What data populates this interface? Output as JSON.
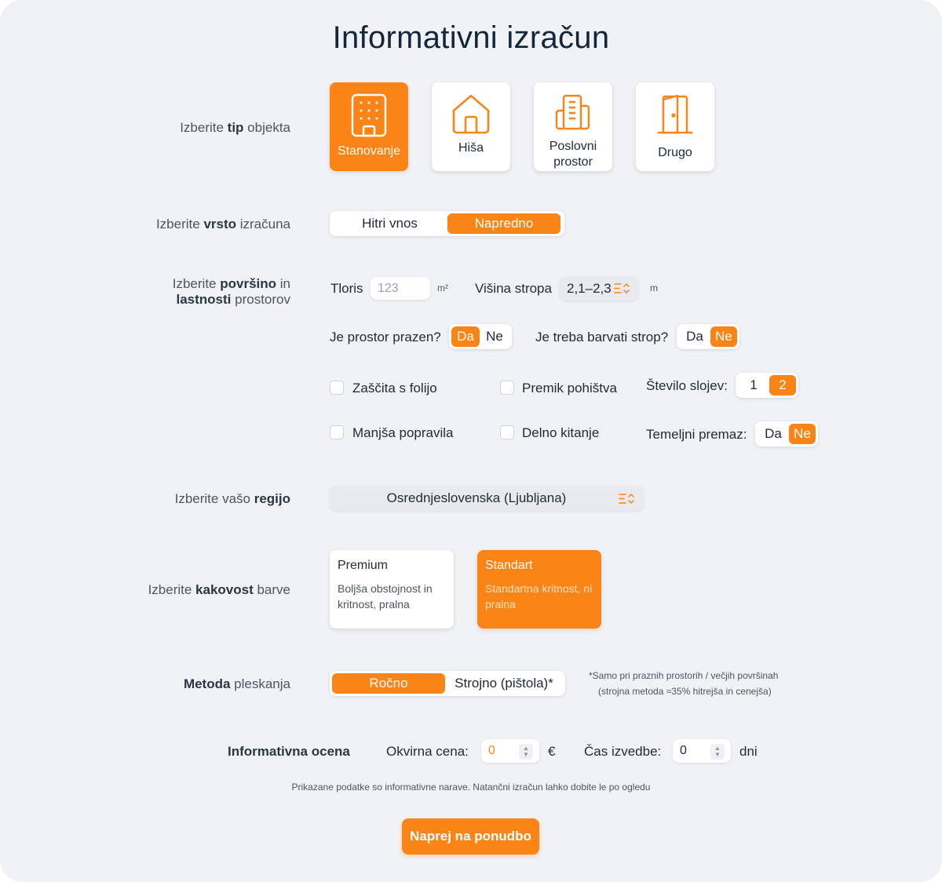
{
  "title": "Informativni izračun",
  "accent_color": "#fb8416",
  "object_type": {
    "label_pre": "Izberite ",
    "label_bold": "tip",
    "label_post": " objekta",
    "options": [
      {
        "label": "Stanovanje",
        "icon": "apartment-building-icon",
        "selected": true
      },
      {
        "label": "Hiša",
        "icon": "house-icon",
        "selected": false
      },
      {
        "label": "Poslovni prostor",
        "icon": "office-building-icon",
        "selected": false
      },
      {
        "label": "Drugo",
        "icon": "door-icon",
        "selected": false
      }
    ]
  },
  "calc_type": {
    "label_pre": "Izberite ",
    "label_bold": "vrsto",
    "label_post": " izračuna",
    "options": [
      "Hitri vnos",
      "Napredno"
    ],
    "selected": "Napredno"
  },
  "surface": {
    "label_pre": "Izberite ",
    "label_bold1": "površino",
    "label_mid": " in",
    "label_bold2": "lastnosti",
    "label_post": " prostorov",
    "tloris_label": "Tloris",
    "tloris_placeholder": "123",
    "tloris_unit": "m²",
    "ceiling_label": "Višina stropa",
    "ceiling_value": "2,1–2,3",
    "ceiling_unit": "m",
    "empty_question": "Je prostor prazen?",
    "empty_options": [
      "Da",
      "Ne"
    ],
    "empty_selected": "Da",
    "paint_ceiling_question": "Je treba barvati strop?",
    "paint_ceiling_options": [
      "Da",
      "Ne"
    ],
    "paint_ceiling_selected": "Ne",
    "checkboxes": [
      {
        "label": "Zaščita s folijo",
        "checked": false
      },
      {
        "label": "Premik pohištva",
        "checked": false
      },
      {
        "label": "Manjša popravila",
        "checked": false
      },
      {
        "label": "Delno kitanje",
        "checked": false
      }
    ],
    "layers_label": "Število slojev:",
    "layers_options": [
      "1",
      "2"
    ],
    "layers_selected": "2",
    "primer_label": "Temeljni premaz:",
    "primer_options": [
      "Da",
      "Ne"
    ],
    "primer_selected": "Ne"
  },
  "region": {
    "label_pre": "Izberite vašo ",
    "label_bold": "regijo",
    "value": "Osrednjeslovenska (Ljubljana)"
  },
  "quality": {
    "label_pre": "Izberite ",
    "label_bold": "kakovost",
    "label_post": " barve",
    "options": [
      {
        "title": "Premium",
        "desc": "Boljša obstojnost in kritnost, pralna",
        "selected": false
      },
      {
        "title": "Standart",
        "desc": "Standartna kritnost, ni pralna",
        "selected": true
      }
    ]
  },
  "method": {
    "label_bold": "Metoda",
    "label_post": " pleskanja",
    "options": [
      "Ročno",
      "Strojno (pištola)*"
    ],
    "selected": "Ročno",
    "note_line1": "*Samo pri praznih prostorih / večjih površinah",
    "note_line2": "(strojna metoda ≈35% hitrejša in cenejša)"
  },
  "estimate": {
    "label": "Informativna ocena",
    "price_label": "Okvirna cena:",
    "price_value": "0",
    "price_unit": "€",
    "time_label": "Čas izvedbe:",
    "time_value": "0",
    "time_unit": "dni"
  },
  "disclaimer": "Prikazane podatke so informativne narave. Natančni izračun lahko dobite le po ogledu",
  "cta_label": "Naprej na ponudbo"
}
